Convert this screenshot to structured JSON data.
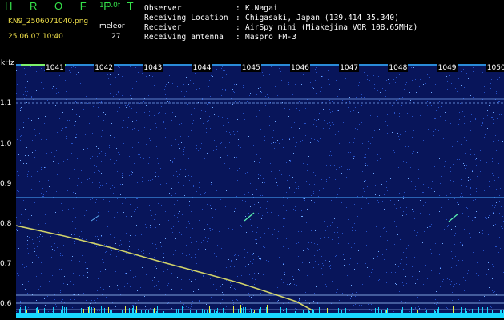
{
  "header": {
    "app_title": "H R O F F T",
    "version": "1.0.0f",
    "filename": "KN9_2506071040.png",
    "datetime": "25.06.07 10:40",
    "meleor_label": "meleor",
    "meleor_count": "27"
  },
  "info": [
    {
      "key": "Observer",
      "value": "K.Nagai"
    },
    {
      "key": "Receiving Location",
      "value": "Chigasaki, Japan (139.414 35.340)"
    },
    {
      "key": "Receiver",
      "value": "AirSpy mini (Miakejima VOR 108.65MHz)"
    },
    {
      "key": "Receiving antenna",
      "value": "Maspro FM-3"
    }
  ],
  "info_separator": ":",
  "spectrogram": {
    "y_unit": "kHz",
    "y_ticks": [
      "1.1",
      "1.0",
      "0.9",
      "0.8",
      "0.7",
      "0.6"
    ],
    "x_ticks": [
      "1041",
      "1042",
      "1043",
      "1044",
      "1045",
      "1046",
      "1047",
      "1048",
      "1049",
      "1050"
    ],
    "colors": {
      "background": "#08155a",
      "noise": "#2a5ad8",
      "trace": "#e8e86a",
      "baseline": "#19d8ff"
    }
  }
}
